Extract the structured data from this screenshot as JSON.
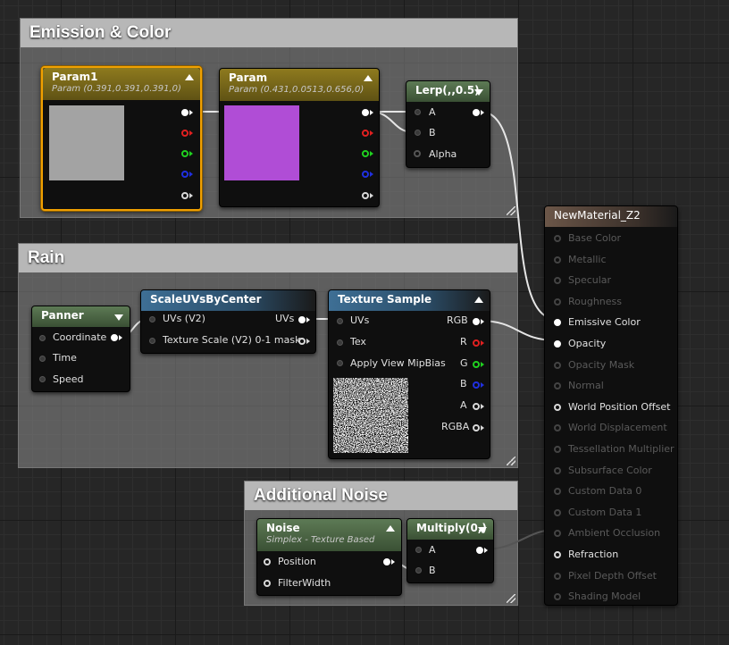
{
  "colors": {
    "param1_swatch": "#a3a3a3",
    "param2_swatch": "#b04dd6",
    "wire": "#e6e6e6",
    "pin_red": "#e02020",
    "pin_green": "#20d020",
    "pin_blue": "#2030e0"
  },
  "comments": {
    "emission": "Emission & Color",
    "rain": "Rain",
    "noise": "Additional Noise"
  },
  "nodes": {
    "param1": {
      "title": "Param1",
      "subtitle": "Param (0.391,0.391,0.391,0)"
    },
    "param2": {
      "title": "Param",
      "subtitle": "Param (0.431,0.0513,0.656,0)"
    },
    "lerp": {
      "title": "Lerp(,,0.5)",
      "pins": [
        "A",
        "B",
        "Alpha"
      ]
    },
    "panner": {
      "title": "Panner",
      "pins": [
        "Coordinate",
        "Time",
        "Speed"
      ]
    },
    "scaleuvs": {
      "title": "ScaleUVsByCenter",
      "pins": [
        "UVs (V2)",
        "Texture Scale (V2) 0-1 mask"
      ],
      "out": "UVs"
    },
    "texsample": {
      "title": "Texture Sample",
      "inputs": [
        "UVs",
        "Tex",
        "Apply View MipBias"
      ],
      "outputs": [
        "RGB",
        "R",
        "G",
        "B",
        "A",
        "RGBA"
      ]
    },
    "noise": {
      "title": "Noise",
      "subtitle": "Simplex - Texture Based",
      "pins": [
        "Position",
        "FilterWidth"
      ]
    },
    "multiply": {
      "title": "Multiply(0,)",
      "pins": [
        "A",
        "B"
      ]
    },
    "result": {
      "title": "NewMaterial_Z2",
      "pins": [
        "Base Color",
        "Metallic",
        "Specular",
        "Roughness",
        "Emissive Color",
        "Opacity",
        "Opacity Mask",
        "Normal",
        "World Position Offset",
        "World Displacement",
        "Tessellation Multiplier",
        "Subsurface Color",
        "Custom Data 0",
        "Custom Data 1",
        "Ambient Occlusion",
        "Refraction",
        "Pixel Depth Offset",
        "Shading Model"
      ],
      "active": [
        false,
        false,
        false,
        false,
        true,
        true,
        false,
        false,
        true,
        false,
        false,
        false,
        false,
        false,
        false,
        true,
        false,
        false
      ]
    }
  }
}
